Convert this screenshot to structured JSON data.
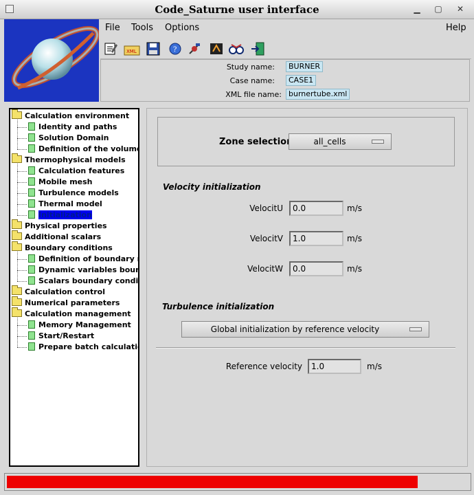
{
  "window": {
    "title": "Code_Saturne user interface"
  },
  "menu": {
    "file": "File",
    "tools": "Tools",
    "options": "Options",
    "help": "Help"
  },
  "toolbar": {
    "icons": [
      "edit-icon",
      "xml-open-icon",
      "save-icon",
      "info-icon",
      "satellite-icon",
      "run-icon",
      "glasses-icon",
      "exit-icon"
    ]
  },
  "study": {
    "study_label": "Study name:",
    "study_value": "BURNER",
    "case_label": "Case name:",
    "case_value": "CASE1",
    "xml_label": "XML file name:",
    "xml_value": "burnertube.xml"
  },
  "tree": [
    {
      "label": "Calculation environment",
      "kind": "folder",
      "level": 0
    },
    {
      "label": "Identity and paths",
      "kind": "doc",
      "level": 1
    },
    {
      "label": "Solution Domain",
      "kind": "doc",
      "level": 1
    },
    {
      "label": "Definition of the volume zones",
      "kind": "doc",
      "level": 1
    },
    {
      "label": "Thermophysical models",
      "kind": "folder",
      "level": 0
    },
    {
      "label": "Calculation features",
      "kind": "doc",
      "level": 1
    },
    {
      "label": "Mobile mesh",
      "kind": "doc",
      "level": 1
    },
    {
      "label": "Turbulence models",
      "kind": "doc",
      "level": 1
    },
    {
      "label": "Thermal model",
      "kind": "doc",
      "level": 1
    },
    {
      "label": "Initialization",
      "kind": "doc",
      "level": 1,
      "selected": true
    },
    {
      "label": "Physical properties",
      "kind": "folder",
      "level": 0
    },
    {
      "label": "Additional scalars",
      "kind": "folder",
      "level": 0
    },
    {
      "label": "Boundary conditions",
      "kind": "folder",
      "level": 0
    },
    {
      "label": "Definition of boundary regions",
      "kind": "doc",
      "level": 1
    },
    {
      "label": "Dynamic variables bound. cond.",
      "kind": "doc",
      "level": 1
    },
    {
      "label": "Scalars boundary conditions",
      "kind": "doc",
      "level": 1
    },
    {
      "label": "Calculation control",
      "kind": "folder",
      "level": 0
    },
    {
      "label": "Numerical parameters",
      "kind": "folder",
      "level": 0
    },
    {
      "label": "Calculation management",
      "kind": "folder",
      "level": 0
    },
    {
      "label": "Memory Management",
      "kind": "doc",
      "level": 1
    },
    {
      "label": "Start/Restart",
      "kind": "doc",
      "level": 1
    },
    {
      "label": "Prepare batch calculation",
      "kind": "doc",
      "level": 1
    }
  ],
  "zone": {
    "label": "Zone selection",
    "value": "all_cells"
  },
  "velocity": {
    "heading": "Velocity initialization",
    "u_label": "VelocitU",
    "u_value": "0.0",
    "v_label": "VelocitV",
    "v_value": "1.0",
    "w_label": "VelocitW",
    "w_value": "0.0",
    "unit": "m/s"
  },
  "turbulence": {
    "heading": "Turbulence initialization",
    "mode": "Global initialization by reference velocity",
    "ref_label": "Reference velocity",
    "ref_value": "1.0",
    "unit": "m/s"
  },
  "progress": {
    "fraction": 0.89,
    "color": "#ee0000"
  }
}
